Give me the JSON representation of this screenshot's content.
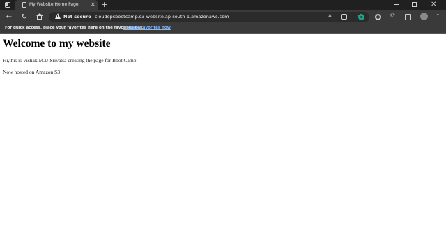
{
  "browser": {
    "tab": {
      "title": "My Website Home Page",
      "close_label": "✕"
    },
    "new_tab_label": "+",
    "window_controls": {
      "minimize_icon": "minimize-icon",
      "maximize_icon": "maximize-icon",
      "close_label": "✕"
    },
    "toolbar": {
      "back_label": "←",
      "refresh_label": "↻",
      "security_label": "Not secure",
      "url": "cloudopsbootcamp.s3-website.ap-south-1.amazonaws.com",
      "read_aloud_label": "A⁾",
      "favorite_star_label": "☆",
      "favorites_label": "✩",
      "more_label": "···"
    },
    "favorites_bar": {
      "message": "For quick access, place your favorites here on the favorites bar.",
      "link": "Manage favorites now"
    }
  },
  "page": {
    "heading": "Welcome to my website",
    "paragraphs": [
      "Hi,this is Vishak M.U Srivatsa creating the page for Boot Camp",
      "Now hosted on Amazon S3!"
    ]
  },
  "colors": {
    "chrome_dark": "#202020",
    "toolbar": "#3a3a3a",
    "link": "#7fb8ff",
    "extension_accent": "#17a589"
  }
}
